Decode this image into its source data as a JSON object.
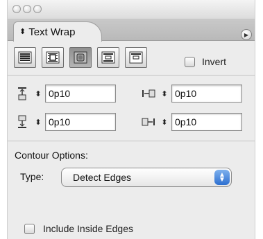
{
  "window": {
    "controls": [
      "close",
      "minimize",
      "zoom"
    ]
  },
  "panel": {
    "tab_label": "Text Wrap",
    "tab_arrow": "⬍",
    "menu_icon": "panel-menu-icon"
  },
  "wrap_buttons": [
    {
      "name": "no-text-wrap",
      "icon": "no-wrap-icon",
      "active": false
    },
    {
      "name": "wrap-around-bounding-box",
      "icon": "bounding-box-wrap-icon",
      "active": false
    },
    {
      "name": "wrap-around-object-shape",
      "icon": "object-shape-wrap-icon",
      "active": true
    },
    {
      "name": "jump-object",
      "icon": "jump-object-icon",
      "active": false
    },
    {
      "name": "jump-to-next-column",
      "icon": "jump-to-next-column-icon",
      "active": false
    }
  ],
  "invert": {
    "label": "Invert",
    "checked": false
  },
  "offsets": {
    "top": {
      "value": "0p10",
      "icon": "top-offset-icon"
    },
    "left": {
      "value": "0p10",
      "icon": "left-offset-icon"
    },
    "bottom": {
      "value": "0p10",
      "icon": "bottom-offset-icon"
    },
    "right": {
      "value": "0p10",
      "icon": "right-offset-icon"
    }
  },
  "contour": {
    "section_label": "Contour Options:",
    "type_label": "Type:",
    "type_value": "Detect Edges"
  },
  "include_inside_edges": {
    "label": "Include Inside Edges",
    "checked": false
  },
  "colors": {
    "panel_bg": "#ececec",
    "tab_bar": "#c0c0c0",
    "select_arrow": "#2d6fd0",
    "active_button": "#9a9a9a"
  }
}
